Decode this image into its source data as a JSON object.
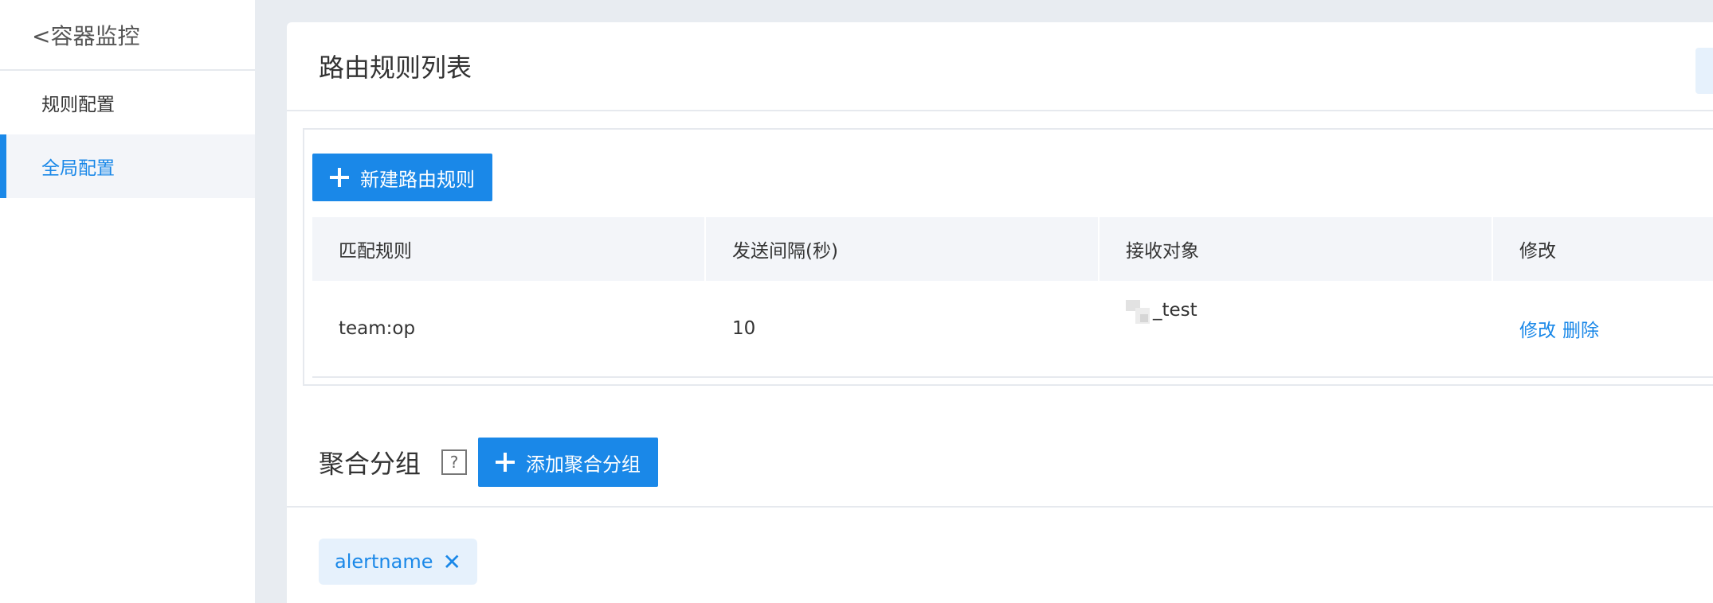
{
  "sidebar": {
    "back_title": "<容器监控",
    "items": [
      {
        "label": "规则配置",
        "active": false
      },
      {
        "label": "全局配置",
        "active": true
      }
    ]
  },
  "route_rules": {
    "title": "路由规则列表",
    "new_button_label": "新建路由规则",
    "columns": [
      "匹配规则",
      "发送间隔(秒)",
      "接收对象",
      "修改"
    ],
    "rows": [
      {
        "match": "team:op",
        "interval": "10",
        "receiver": "_test",
        "actions": [
          "修改",
          "删除"
        ]
      }
    ]
  },
  "aggregation": {
    "title": "聚合分组",
    "help_label": "?",
    "add_button_label": "添加聚合分组",
    "tags": [
      {
        "label": "alertname",
        "close": "✕"
      }
    ]
  },
  "colors": {
    "accent": "#1a88e8",
    "page_bg": "#e8ecf1",
    "header_bg": "#f3f5f9"
  }
}
